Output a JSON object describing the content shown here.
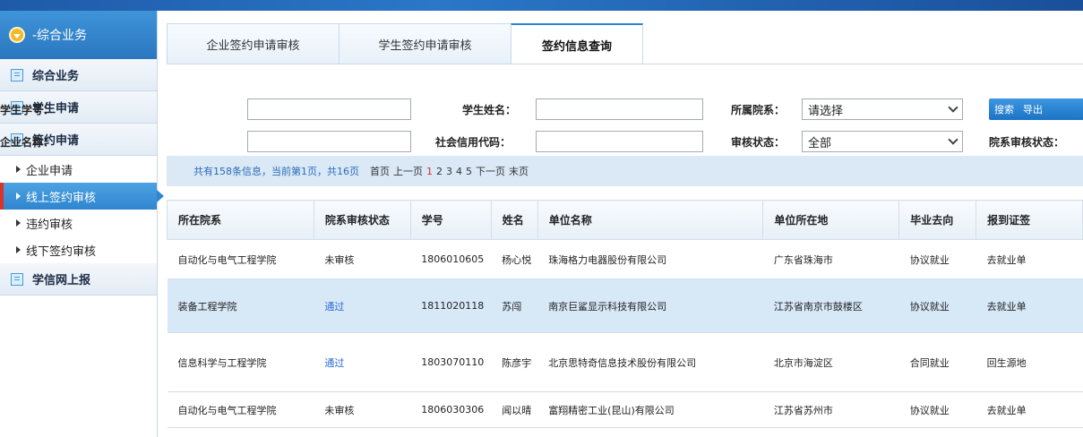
{
  "sidebar": {
    "header": "-综合业务",
    "sections": [
      "综合业务",
      "学生申请",
      "签约申请"
    ],
    "subitems": [
      "企业申请",
      "线上签约审核",
      "违约审核",
      "线下签约审核"
    ],
    "footer_section": "学信网上报"
  },
  "tabs": [
    "企业签约申请审核",
    "学生签约申请审核",
    "签约信息查询"
  ],
  "filters": {
    "student_no_label": "学生学号：",
    "student_name_label": "学生姓名：",
    "college_label": "所属院系：",
    "college_value": "请选择",
    "company_label": "企业名称：",
    "credit_code_label": "社会信用代码：",
    "audit_label": "审核状态：",
    "audit_value": "全部",
    "college_audit_label": "院系审核状态：",
    "search_button": "搜索",
    "export_button": "导出"
  },
  "pager": {
    "info": "共有158条信息，当前第1页，共16页",
    "first": "首页",
    "prev": "上一页",
    "pages": [
      "1",
      "2",
      "3",
      "4",
      "5"
    ],
    "next": "下一页",
    "last": "末页"
  },
  "table": {
    "headers": [
      "所在院系",
      "院系审核状态",
      "学号",
      "姓名",
      "单位名称",
      "单位所在地",
      "毕业去向",
      "报到证签"
    ],
    "rows": [
      [
        "自动化与电气工程学院",
        "未审核",
        "1806010605",
        "杨心悦",
        "珠海格力电器股份有限公司",
        "广东省珠海市",
        "协议就业",
        "去就业单"
      ],
      [
        "装备工程学院",
        "通过",
        "1811020118",
        "苏闯",
        "南京巨鲨显示科技有限公司",
        "江苏省南京市鼓楼区",
        "协议就业",
        "去就业单"
      ],
      [
        "信息科学与工程学院",
        "通过",
        "1803070110",
        "陈彦宇",
        "北京思特奇信息技术股份有限公司",
        "北京市海淀区",
        "合同就业",
        "回生源地"
      ],
      [
        "自动化与电气工程学院",
        "未审核",
        "1806030306",
        "闻以晴",
        "富翔精密工业(昆山)有限公司",
        "江苏省苏州市",
        "协议就业",
        "去就业单"
      ]
    ]
  },
  "colors": {
    "accent": "#2d83cf",
    "active_marker": "#d8342c",
    "pass_text": "#2a6bd0"
  }
}
